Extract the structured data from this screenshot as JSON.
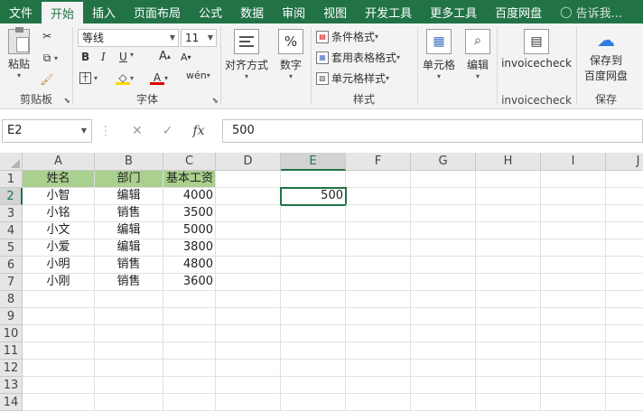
{
  "ribbon": {
    "tabs": [
      "文件",
      "开始",
      "插入",
      "页面布局",
      "公式",
      "数据",
      "审阅",
      "视图",
      "开发工具",
      "更多工具",
      "百度网盘",
      "告诉我..."
    ],
    "clipboard": {
      "paste": "粘贴",
      "group": "剪贴板"
    },
    "font": {
      "name": "等线",
      "size": "11",
      "group": "字体",
      "bold": "B",
      "italic": "I",
      "underline": "U",
      "grow": "A",
      "shrink": "A",
      "fontcolor": "A",
      "phonetic": "wén"
    },
    "alignment": {
      "label": "对齐方式"
    },
    "number": {
      "label": "数字",
      "symbol": "%"
    },
    "styles": {
      "cond": "条件格式",
      "table": "套用表格格式",
      "cell": "单元格样式",
      "group": "样式"
    },
    "cells": {
      "label": "单元格"
    },
    "editing": {
      "label": "编辑"
    },
    "invoice": {
      "label": "invoicecheck",
      "group": "invoicecheck"
    },
    "save": {
      "line1": "保存到",
      "line2": "百度网盘",
      "group": "保存"
    }
  },
  "formula_bar": {
    "name_box": "E2",
    "value": "500",
    "fx": "fx",
    "cancel": "✕",
    "enter": "✓"
  },
  "sheet": {
    "columns": [
      "A",
      "B",
      "C",
      "D",
      "E",
      "F",
      "G",
      "H",
      "I",
      "J"
    ],
    "rows": [
      "1",
      "2",
      "3",
      "4",
      "5",
      "6",
      "7",
      "8",
      "9",
      "10",
      "11",
      "12",
      "13",
      "14"
    ],
    "headers": [
      "姓名",
      "部门",
      "基本工资"
    ],
    "data": [
      [
        "小智",
        "编辑",
        "4000"
      ],
      [
        "小铭",
        "销售",
        "3500"
      ],
      [
        "小文",
        "编辑",
        "5000"
      ],
      [
        "小爱",
        "编辑",
        "3800"
      ],
      [
        "小明",
        "销售",
        "4800"
      ],
      [
        "小刚",
        "销售",
        "3600"
      ]
    ],
    "e2": "500"
  },
  "colors": {
    "accent": "#217346",
    "header_fill": "#a9d08e"
  }
}
